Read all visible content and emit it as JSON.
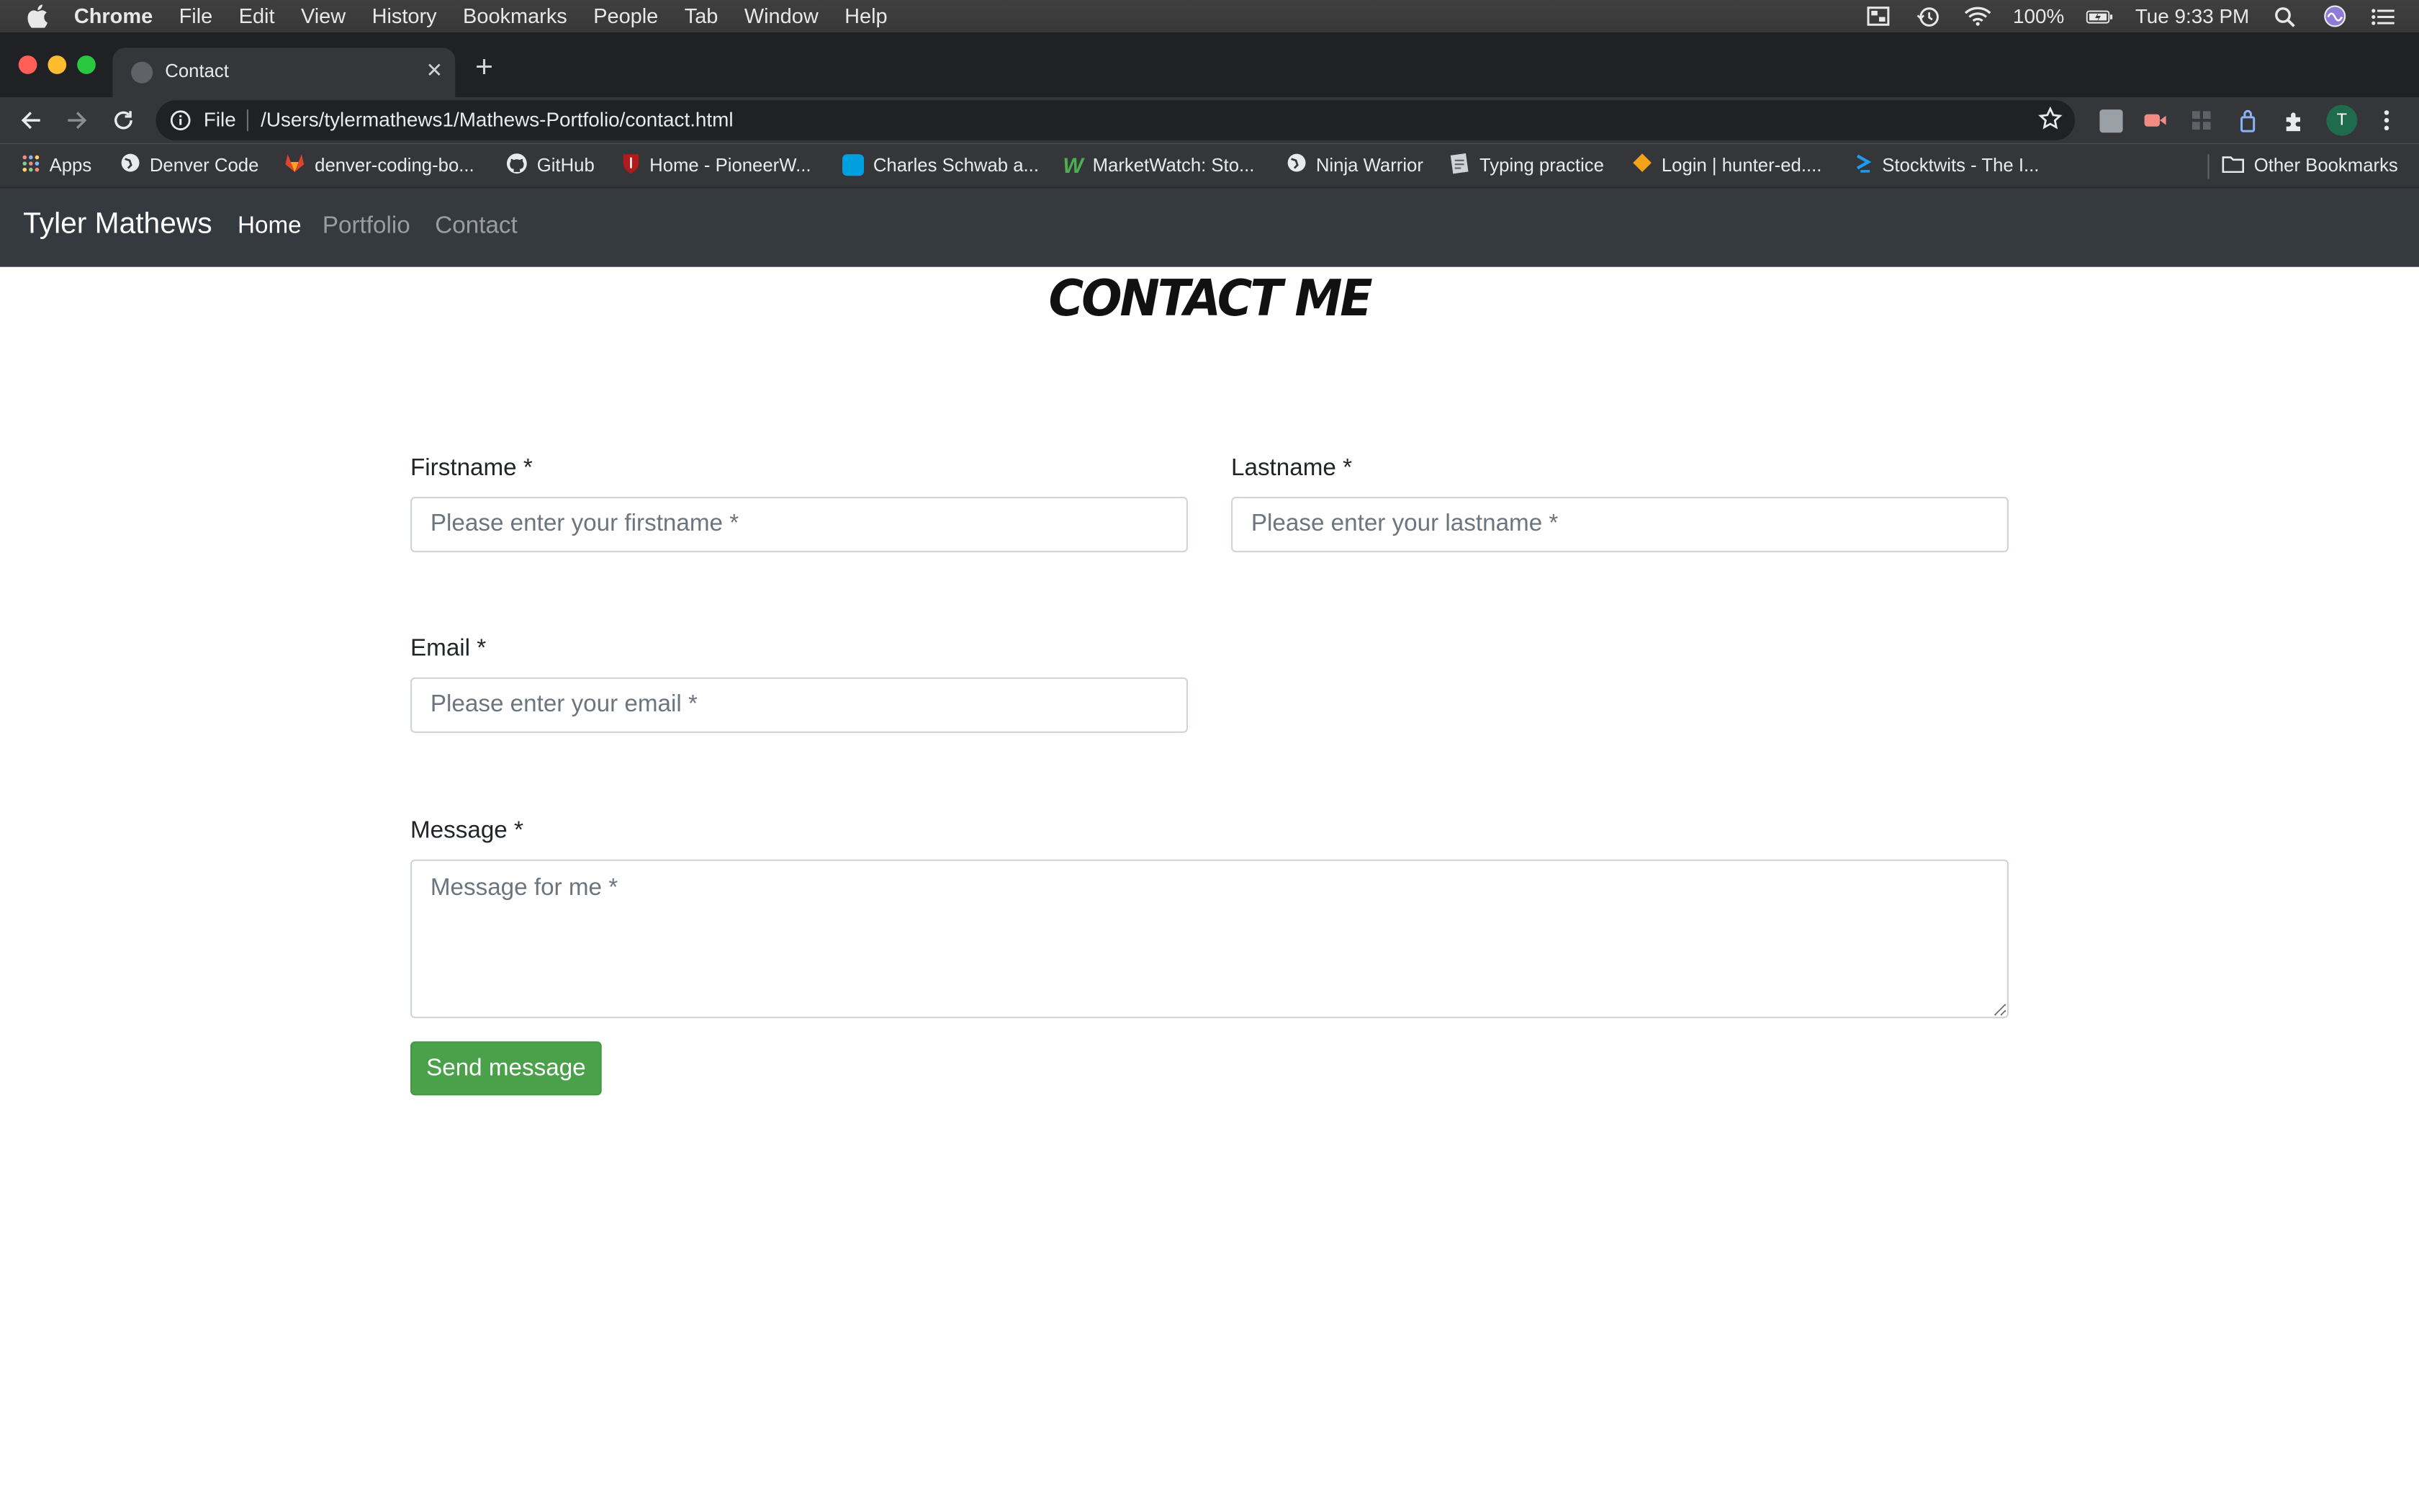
{
  "menubar": {
    "app": "Chrome",
    "items": [
      "File",
      "Edit",
      "View",
      "History",
      "Bookmarks",
      "People",
      "Tab",
      "Window",
      "Help"
    ],
    "battery": "100%",
    "clock": "Tue 9:33 PM"
  },
  "browser": {
    "tab_title": "Contact",
    "scheme_label": "File",
    "url": "/Users/tylermathews1/Mathews-Portfolio/contact.html",
    "profile_initial": "T",
    "bookmarks": [
      "Apps",
      "Denver Code",
      "denver-coding-bo...",
      "GitHub",
      "Home - PioneerW...",
      "Charles Schwab a...",
      "MarketWatch: Sto...",
      "Ninja Warrior",
      "Typing practice",
      "Login | hunter-ed....",
      "Stocktwits - The I..."
    ],
    "other_bookmarks": "Other Bookmarks"
  },
  "site": {
    "brand": "Tyler Mathews",
    "nav": [
      "Home",
      "Portfolio",
      "Contact"
    ]
  },
  "form": {
    "heading": "CONTACT ME",
    "firstname_label": "Firstname *",
    "firstname_placeholder": "Please enter your firstname *",
    "lastname_label": "Lastname *",
    "lastname_placeholder": "Please enter your lastname *",
    "email_label": "Email *",
    "email_placeholder": "Please enter your email *",
    "message_label": "Message *",
    "message_placeholder": "Message for me *",
    "submit_label": "Send message"
  },
  "colors": {
    "navbar_bg": "#343a40",
    "submit_bg": "#4aa14a",
    "chrome_toolbar": "#35363a"
  }
}
